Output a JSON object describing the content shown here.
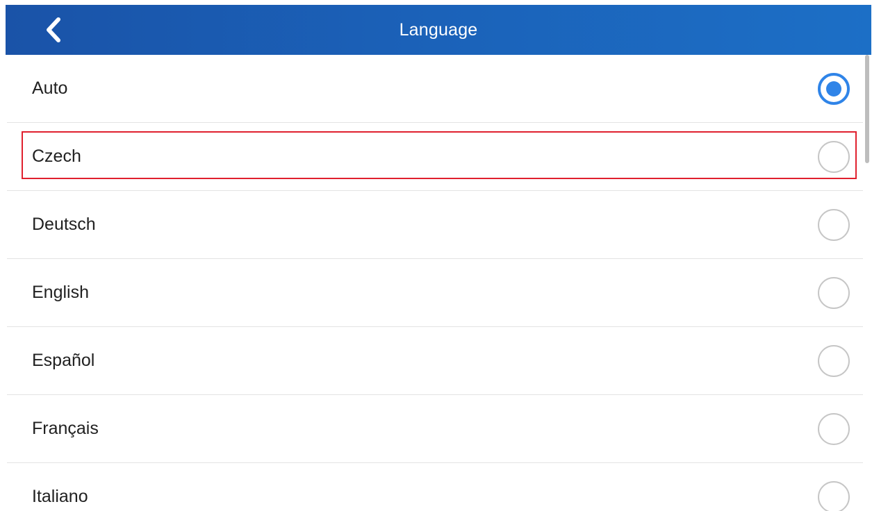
{
  "header": {
    "title": "Language",
    "back_icon": "chevron-left-icon",
    "background_color": "#1b62b9"
  },
  "languages": [
    {
      "label": "Auto",
      "selected": true
    },
    {
      "label": "Czech",
      "selected": false
    },
    {
      "label": "Deutsch",
      "selected": false
    },
    {
      "label": "English",
      "selected": false
    },
    {
      "label": "Español",
      "selected": false
    },
    {
      "label": "Français",
      "selected": false
    },
    {
      "label": "Italiano",
      "selected": false
    }
  ],
  "highlighted_item": "Czech",
  "colors": {
    "accent": "#2f84e8",
    "highlight_border": "#e0202e",
    "radio_unchecked": "#c6c6c6"
  }
}
